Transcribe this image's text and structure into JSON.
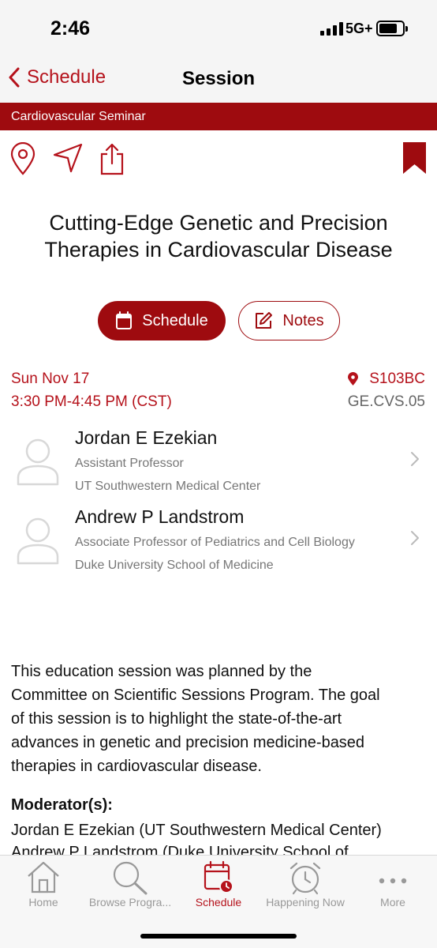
{
  "status_bar": {
    "time": "2:46",
    "network": "5G+"
  },
  "nav": {
    "back_label": "Schedule",
    "title": "Session"
  },
  "banner": {
    "text": "Cardiovascular Seminar"
  },
  "actions": {
    "icons": [
      "map-pin-icon",
      "send-icon",
      "share-icon",
      "bookmark-icon"
    ]
  },
  "session": {
    "title_line1": "Cutting-Edge Genetic and Precision",
    "title_line2": "Therapies in Cardiovascular Disease",
    "schedule_button": "Schedule",
    "notes_button": "Notes",
    "date": "Sun Nov 17",
    "time": "3:30 PM-4:45 PM (CST)",
    "room": "S103BC",
    "code": "GE.CVS.05"
  },
  "speakers": [
    {
      "name": "Jordan E Ezekian",
      "role": "Assistant Professor",
      "org": "UT Southwestern Medical Center"
    },
    {
      "name": "Andrew P Landstrom",
      "role": "Associate Professor of Pediatrics and Cell Biology",
      "org": "Duke University School of Medicine"
    }
  ],
  "description": {
    "line1": "This education session was planned by the",
    "line2": "Committee on Scientific Sessions Program. The goal",
    "line3": "of this session is to highlight the state-of-the-art",
    "line4": "advances in genetic and precision medicine-based",
    "line5": "therapies in cardiovascular disease."
  },
  "moderators": {
    "label": "Moderator(s):",
    "line1": "Jordan E Ezekian (UT Southwestern Medical Center)",
    "line2": "Andrew P Landstrom (Duke University School of"
  },
  "tabbar": {
    "tabs": [
      {
        "label": "Home",
        "icon": "home-icon"
      },
      {
        "label": "Browse Progra...",
        "icon": "search-icon"
      },
      {
        "label": "Schedule",
        "icon": "calendar-clock-icon"
      },
      {
        "label": "Happening Now",
        "icon": "alarm-clock-icon"
      },
      {
        "label": "More",
        "icon": "more-dots-icon"
      }
    ],
    "active": "Schedule"
  },
  "colors": {
    "accent": "#9e0b0f",
    "link": "#b5121b",
    "muted": "#777777"
  }
}
